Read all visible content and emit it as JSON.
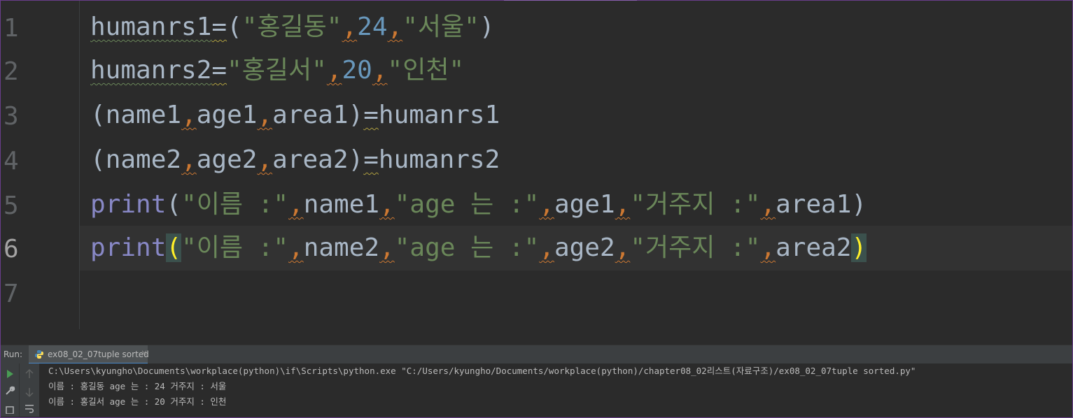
{
  "editor": {
    "line_numbers": [
      "1",
      "2",
      "3",
      "4",
      "5",
      "6",
      "7"
    ],
    "lines": {
      "l1": {
        "var": "humanrs1",
        "eq": "=",
        "open": "(",
        "s1": "\"홍길동\"",
        "c1": ",",
        "n1": "24",
        "c2": ",",
        "s2": "\"서울\"",
        "close": ")"
      },
      "l2": {
        "var": "humanrs2",
        "eq": "=",
        "s1": "\"홍길서\"",
        "c1": ",",
        "n1": "20",
        "c2": ",",
        "s2": "\"인천\""
      },
      "l3": {
        "open": "(",
        "a": "name1",
        "c1": ",",
        "b": "age1",
        "c2": ",",
        "c": "area1",
        "close": ")",
        "eq": "=",
        "rhs": "humanrs1"
      },
      "l4": {
        "open": "(",
        "a": "name2",
        "c1": ",",
        "b": "age2",
        "c2": ",",
        "c": "area2",
        "close": ")",
        "eq": "=",
        "rhs": "humanrs2"
      },
      "l5": {
        "fn": "print",
        "open": "(",
        "s1": "\"이름 :\"",
        "c1": ",",
        "a": "name1",
        "c2": ",",
        "s2": "\"age 는 :\"",
        "c3": ",",
        "b": "age1",
        "c4": ",",
        "s3": "\"거주지 :\"",
        "c5": ",",
        "c": "area1",
        "close": ")"
      },
      "l6": {
        "fn": "print",
        "open": "(",
        "s1": "\"이름 :\"",
        "c1": ",",
        "a": "name2",
        "c2": ",",
        "s2": "\"age 는 :\"",
        "c3": ",",
        "b": "age2",
        "c4": ",",
        "s3": "\"거주지 :\"",
        "c5": ",",
        "c": "area2",
        "close": ")"
      }
    }
  },
  "run_panel": {
    "label": "Run:",
    "tab_label": "ex08_02_07tuple sorted",
    "close_glyph": "×",
    "output": [
      "C:\\Users\\kyungho\\Documents\\workplace(python)\\if\\Scripts\\python.exe \"C:/Users/kyungho/Documents/workplace(python)/chapter08_02리스트(자료구조)/ex08_02_07tuple sorted.py\"",
      "이름 : 홍길동 age 는 : 24 거주지 : 서울",
      "이름 : 홍길서 age 는 : 20 거주지 : 인천"
    ]
  },
  "colors": {
    "background": "#2b2b2b",
    "string": "#6a8759",
    "number": "#6897bb",
    "keyword": "#8888c6",
    "comma": "#cc7832",
    "brace_match": "#ffef28"
  },
  "icons": [
    "python-file-icon",
    "close-icon",
    "run-icon",
    "rerun-icon",
    "up-arrow-icon",
    "down-arrow-icon",
    "wrench-icon",
    "soft-wrap-icon"
  ]
}
